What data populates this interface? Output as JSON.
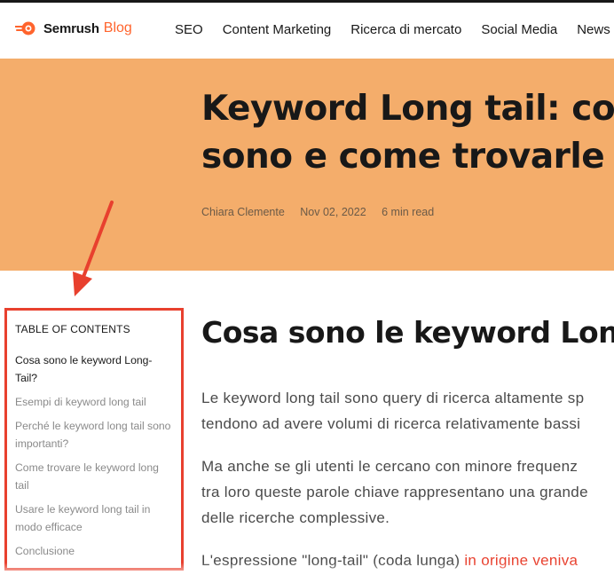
{
  "header": {
    "brand": "Semrush",
    "brand_suffix": "Blog",
    "nav": [
      "SEO",
      "Content Marketing",
      "Ricerca di mercato",
      "Social Media",
      "News"
    ]
  },
  "hero": {
    "title_lines": [
      "Keyword Long tail: cosa",
      "sono e come trovarle"
    ],
    "author": "Chiara Clemente",
    "date": "Nov 02, 2022",
    "read_time": "6 min read"
  },
  "toc": {
    "title": "TABLE OF CONTENTS",
    "items": [
      {
        "label": "Cosa sono le keyword Long-Tail?",
        "active": true
      },
      {
        "label": "Esempi di keyword long tail",
        "active": false
      },
      {
        "label": "Perché le keyword long tail sono importanti?",
        "active": false
      },
      {
        "label": "Come trovare le keyword long tail",
        "active": false
      },
      {
        "label": "Usare le keyword long tail in modo efficace",
        "active": false
      },
      {
        "label": "Conclusione",
        "active": false
      }
    ]
  },
  "article": {
    "heading": "Cosa sono le keyword Long",
    "p1_lines": [
      "Le keyword long tail sono query di ricerca altamente sp",
      "tendono ad avere volumi di ricerca relativamente bassi"
    ],
    "p2_lines": [
      "Ma anche se gli utenti le cercano con minore frequenz",
      "tra loro queste parole chiave rappresentano una grande",
      "delle ricerche complessive."
    ],
    "p3_text": "L'espressione \"long-tail\" (coda lunga) ",
    "p3_link": "in origine veniva"
  },
  "colors": {
    "accent": "#ff642d",
    "hero_bg": "#f4ad6b",
    "annotation": "#e8402e"
  }
}
